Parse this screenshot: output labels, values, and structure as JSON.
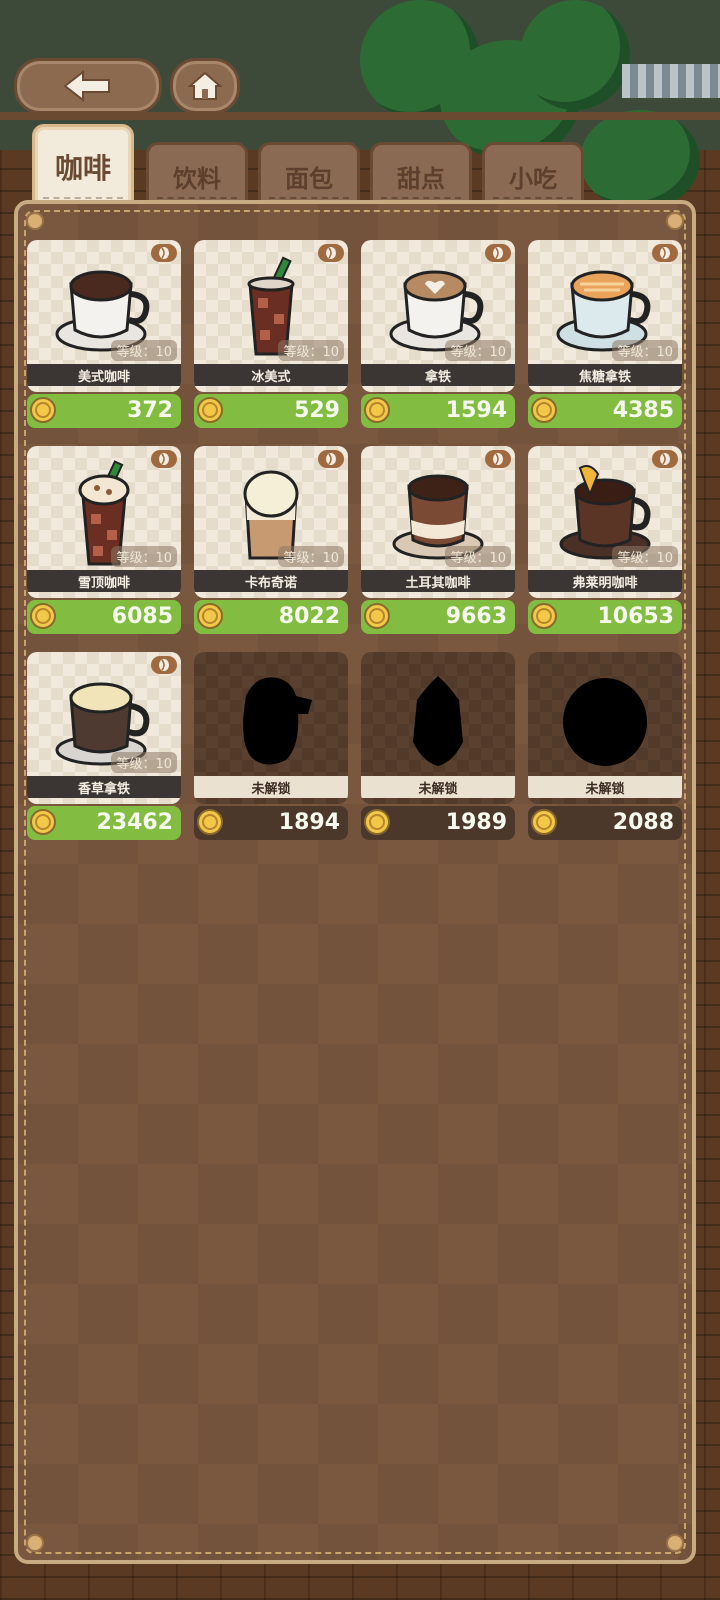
{
  "tabs": [
    {
      "label": "咖啡",
      "active": true
    },
    {
      "label": "饮料",
      "active": false
    },
    {
      "label": "面包",
      "active": false
    },
    {
      "label": "甜点",
      "active": false
    },
    {
      "label": "小吃",
      "active": false
    }
  ],
  "level_label": "等级：",
  "items": [
    {
      "name": "美式咖啡",
      "level": "10",
      "price": "372",
      "unlocked": true,
      "icon": "black-coffee-cup"
    },
    {
      "name": "冰美式",
      "level": "10",
      "price": "529",
      "unlocked": true,
      "icon": "iced-americano-glass"
    },
    {
      "name": "拿铁",
      "level": "10",
      "price": "1594",
      "unlocked": true,
      "icon": "latte-art-cup"
    },
    {
      "name": "焦糖拿铁",
      "level": "10",
      "price": "4385",
      "unlocked": true,
      "icon": "caramel-latte-cup"
    },
    {
      "name": "雪顶咖啡",
      "level": "10",
      "price": "6085",
      "unlocked": true,
      "icon": "float-coffee-glass"
    },
    {
      "name": "卡布奇诺",
      "level": "10",
      "price": "8022",
      "unlocked": true,
      "icon": "cappuccino-glass"
    },
    {
      "name": "土耳其咖啡",
      "level": "10",
      "price": "9663",
      "unlocked": true,
      "icon": "turkish-coffee-cup"
    },
    {
      "name": "弗莱明咖啡",
      "level": "10",
      "price": "10653",
      "unlocked": true,
      "icon": "flaming-coffee-cup"
    },
    {
      "name": "香草拿铁",
      "level": "10",
      "price": "23462",
      "unlocked": true,
      "icon": "vanilla-latte-cup"
    },
    {
      "name": "未解锁",
      "level": "",
      "price": "1894",
      "unlocked": false,
      "icon": "locked-silhouette"
    },
    {
      "name": "未解锁",
      "level": "",
      "price": "1989",
      "unlocked": false,
      "icon": "locked-silhouette"
    },
    {
      "name": "未解锁",
      "level": "",
      "price": "2088",
      "unlocked": false,
      "icon": "locked-silhouette"
    }
  ],
  "colors": {
    "price_unlocked": "#82bd42",
    "price_locked": "#4b382a",
    "panel": "#7a5840",
    "card": "#f1e9dc"
  }
}
